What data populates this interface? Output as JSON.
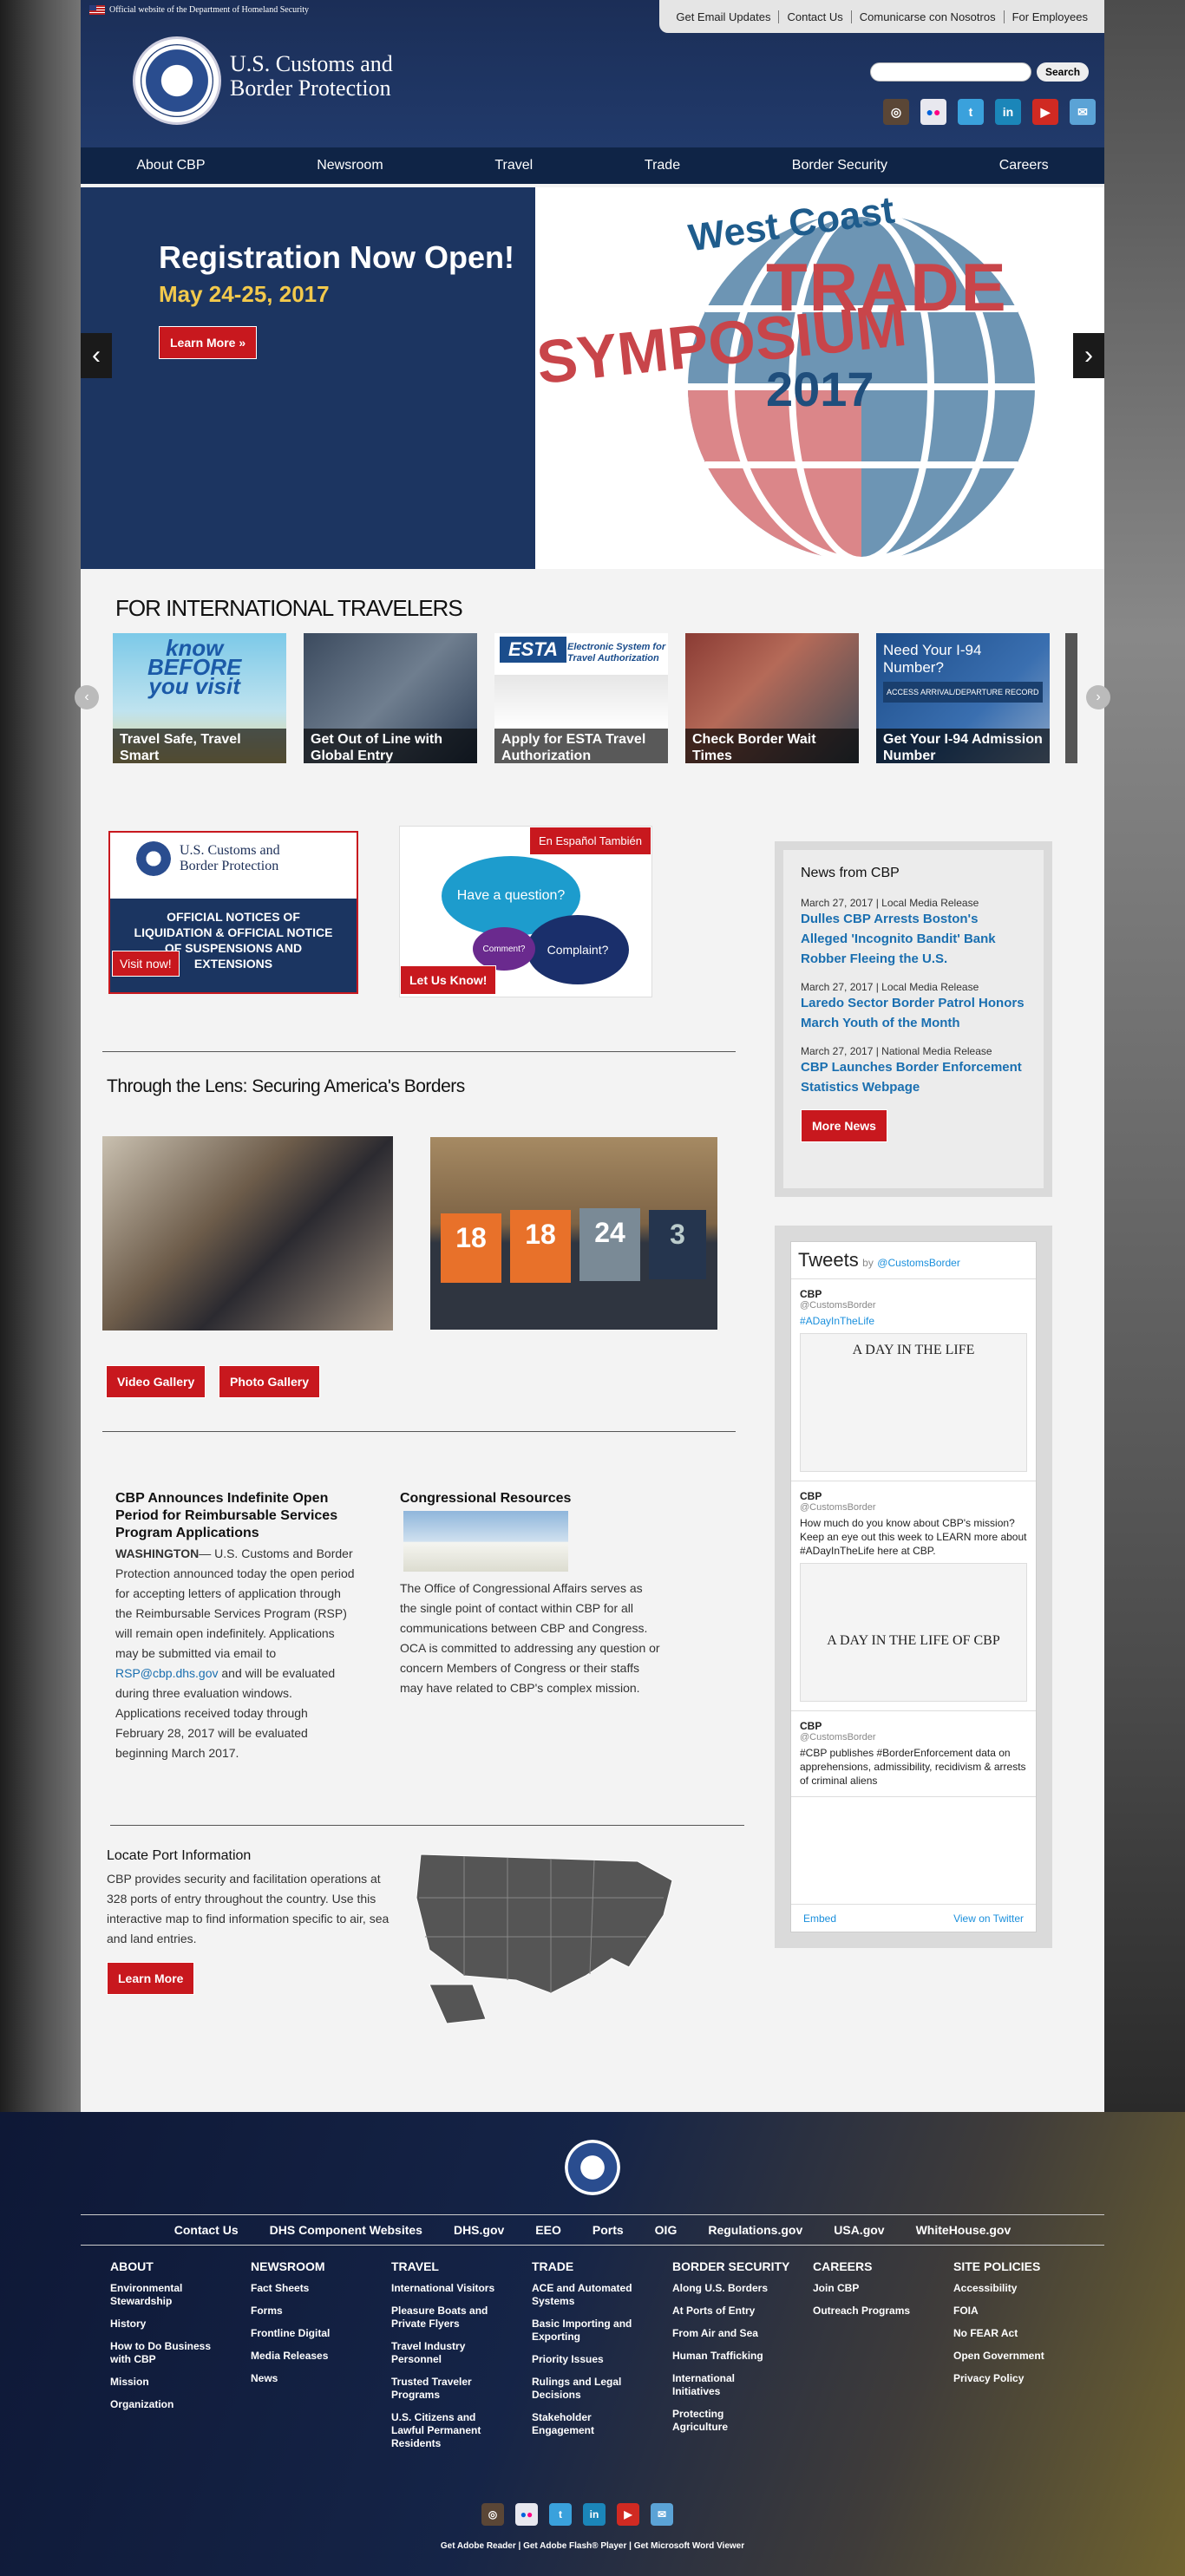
{
  "header": {
    "official": "Official website of the Department of Homeland Security",
    "toplinks": [
      "Get Email Updates",
      "Contact Us",
      "Comunicarse con Nosotros",
      "For Employees"
    ],
    "brand_line1": "U.S. Customs and",
    "brand_line2": "Border Protection",
    "search_button": "Search",
    "social": [
      "instagram-icon",
      "flickr-icon",
      "twitter-icon",
      "linkedin-icon",
      "youtube-icon",
      "email-icon"
    ]
  },
  "nav": [
    "About CBP",
    "Newsroom",
    "Travel",
    "Trade",
    "Border Security",
    "Careers"
  ],
  "hero": {
    "heading": "Registration Now Open!",
    "dates": "May 24-25, 2017",
    "button": "Learn More »",
    "graphic_line1": "West Coast",
    "graphic_line2": "TRADE",
    "graphic_line3": "SYMPOSIUM",
    "graphic_line4": "2017"
  },
  "travelers": {
    "title": "FOR INTERNATIONAL TRAVELERS",
    "cards": [
      "Travel Safe, Travel Smart",
      "Get Out of Line with Global Entry",
      "Apply for ESTA Travel Authorization",
      "Check Border Wait Times",
      "Get Your I-94 Admission Number"
    ],
    "card1_art1": "know",
    "card1_art2": "BEFORE",
    "card1_art3": "you visit",
    "card3_art_logo": "ESTA",
    "card3_art1": "Electronic System for",
    "card3_art2": "Travel Authorization",
    "card5_art1": "Need Your I-94",
    "card5_art2": "Number?",
    "card5_art3": "ACCESS ARRIVAL/DEPARTURE RECORD"
  },
  "promos": {
    "liq_brand1": "U.S. Customs and",
    "liq_brand2": "Border Protection",
    "liq_text": "OFFICIAL NOTICES OF LIQUIDATION & OFFICIAL NOTICE OF SUSPENSIONS AND EXTENSIONS",
    "liq_button": "Visit now!",
    "q_badge": "En Español También",
    "q_bubble1": "Have a question?",
    "q_bubble2": "Complaint?",
    "q_bubble3": "Comment?",
    "q_button": "Let Us Know!"
  },
  "lens": {
    "title": "Through the Lens: Securing America's Borders",
    "video_button": "Video Gallery",
    "photo_button": "Photo Gallery",
    "jersey1": "18",
    "jersey2": "18",
    "jersey3": "24",
    "jersey4": "3"
  },
  "news": {
    "title": "News from CBP",
    "items": [
      {
        "date": "March 27, 2017 | Local Media Release",
        "title": "Dulles CBP Arrests Boston's Alleged 'Incognito Bandit' Bank Robber Fleeing the U.S."
      },
      {
        "date": "March 27, 2017 | Local Media Release",
        "title": "Laredo Sector Border Patrol Honors March Youth of the Month"
      },
      {
        "date": "March 27, 2017 | National Media Release",
        "title": "CBP Launches Border Enforcement Statistics Webpage"
      }
    ],
    "button": "More News"
  },
  "article1": {
    "title": "CBP Announces Indefinite Open Period for Reimbursable Services Program Applications",
    "dateline": "WASHINGTON",
    "body1": "— U.S. Customs and Border Protection announced today the open period for accepting letters of application through the Reimbursable Services Program (RSP) will remain open indefinitely. Applications may be submitted via email to ",
    "email": "RSP@cbp.dhs.gov",
    "body2": " and will be evaluated during three evaluation windows. Applications received today through February 28, 2017 will be evaluated beginning March 2017."
  },
  "article2": {
    "title": "Congressional Resources",
    "body": "The Office of Congressional Affairs serves as the single point of contact within CBP for all communications between CBP and Congress. OCA is committed to addressing any question or concern Members of Congress or their staffs may have related to CBP's complex mission."
  },
  "port": {
    "title": "Locate Port Information",
    "body": "CBP provides security and facilitation operations at 328 ports of entry throughout the country. Use this interactive map to find information specific to air, sea and land entries.",
    "button": "Learn More"
  },
  "tweets": {
    "title": "Tweets",
    "by": "by",
    "handle": "@CustomsBorder",
    "items": [
      {
        "name": "CBP",
        "handle": "@CustomsBorder",
        "text": "#ADayInTheLife",
        "img": "A DAY IN THE LIFE"
      },
      {
        "name": "CBP",
        "handle": "@CustomsBorder",
        "text": "How much do you know about CBP's mission? Keep an eye out this week to LEARN more about #ADayInTheLife here at CBP.",
        "img": "A DAY IN THE LIFE OF CBP"
      },
      {
        "name": "CBP",
        "handle": "@CustomsBorder",
        "text": "#CBP publishes #BorderEnforcement data on apprehensions, admissibility, recidivism & arrests of criminal aliens"
      }
    ],
    "embed": "Embed",
    "view": "View on Twitter"
  },
  "footer": {
    "links": [
      "Contact Us",
      "DHS Component Websites",
      "DHS.gov",
      "EEO",
      "Ports",
      "OIG",
      "Regulations.gov",
      "USA.gov",
      "WhiteHouse.gov"
    ],
    "columns": [
      {
        "title": "ABOUT",
        "items": [
          "Environmental Stewardship",
          "History",
          "How to Do Business with CBP",
          "Mission",
          "Organization"
        ]
      },
      {
        "title": "NEWSROOM",
        "items": [
          "Fact Sheets",
          "Forms",
          "Frontline Digital",
          "Media Releases",
          "News"
        ]
      },
      {
        "title": "TRAVEL",
        "items": [
          "International Visitors",
          "Pleasure Boats and Private Flyers",
          "Travel Industry Personnel",
          "Trusted Traveler Programs",
          "U.S. Citizens and Lawful Permanent Residents"
        ]
      },
      {
        "title": "TRADE",
        "items": [
          "ACE and Automated Systems",
          "Basic Importing and Exporting",
          "Priority Issues",
          "Rulings and Legal Decisions",
          "Stakeholder Engagement"
        ]
      },
      {
        "title": "BORDER SECURITY",
        "items": [
          "Along U.S. Borders",
          "At Ports of Entry",
          "From Air and Sea",
          "Human Trafficking",
          "International Initiatives",
          "Protecting Agriculture"
        ]
      },
      {
        "title": "CAREERS",
        "items": [
          "Join CBP",
          "Outreach Programs"
        ]
      },
      {
        "title": "SITE POLICIES",
        "items": [
          "Accessibility",
          "FOIA",
          "No FEAR Act",
          "Open Government",
          "Privacy Policy"
        ]
      }
    ],
    "bottom": "Get Adobe Reader | Get Adobe Flash® Player | Get Microsoft Word Viewer"
  },
  "colors": {
    "navy": "#1b2e57",
    "red": "#c8181e",
    "link": "#1a6fb0"
  }
}
